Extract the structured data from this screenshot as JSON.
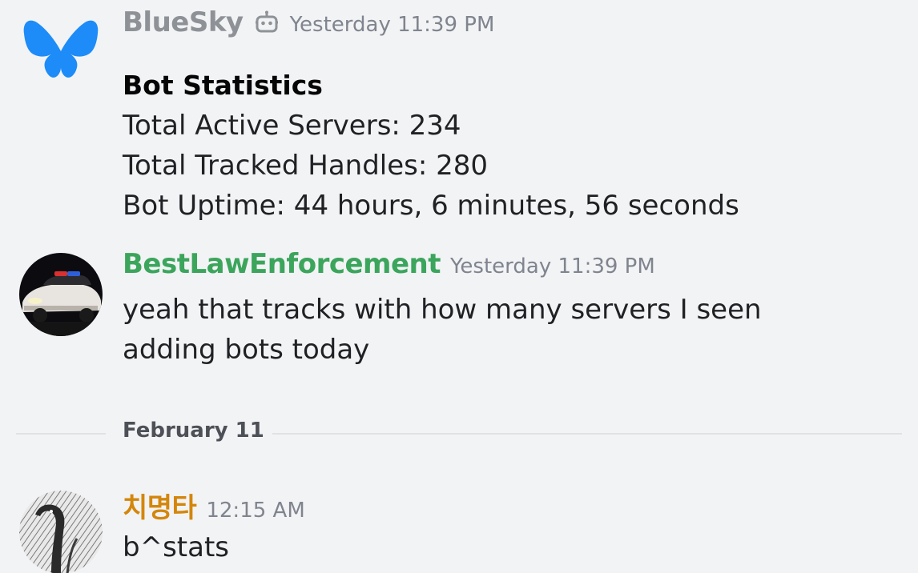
{
  "messages": [
    {
      "author": "BlueSky",
      "author_color": "#8e9297",
      "is_bot": true,
      "avatar_icon": "butterfly-logo-icon",
      "timestamp": "Yesterday 11:39 PM",
      "embed": {
        "title": "Bot Statistics",
        "lines": [
          "Total Active Servers: 234",
          "Total Tracked Handles: 280",
          "Bot Uptime: 44 hours, 6 minutes, 56 seconds"
        ]
      }
    },
    {
      "author": "BestLawEnforcement",
      "author_color": "#3ba55c",
      "avatar_icon": "police-car-avatar",
      "timestamp": "Yesterday 11:39 PM",
      "text_lines": [
        "yeah that tracks with how many servers I seen",
        "adding bots today"
      ]
    },
    {
      "author": "치명타",
      "author_color": "#d4860b",
      "avatar_icon": "bird-sketch-avatar",
      "timestamp": "12:15 AM",
      "text_lines": [
        "b^stats"
      ]
    }
  ],
  "date_divider": {
    "label": "February 11"
  },
  "colors": {
    "background": "#f2f3f5",
    "bluesky_brand": "#1d8cf8",
    "timestamp": "#80848e",
    "divider_line": "#dfe1e5"
  }
}
